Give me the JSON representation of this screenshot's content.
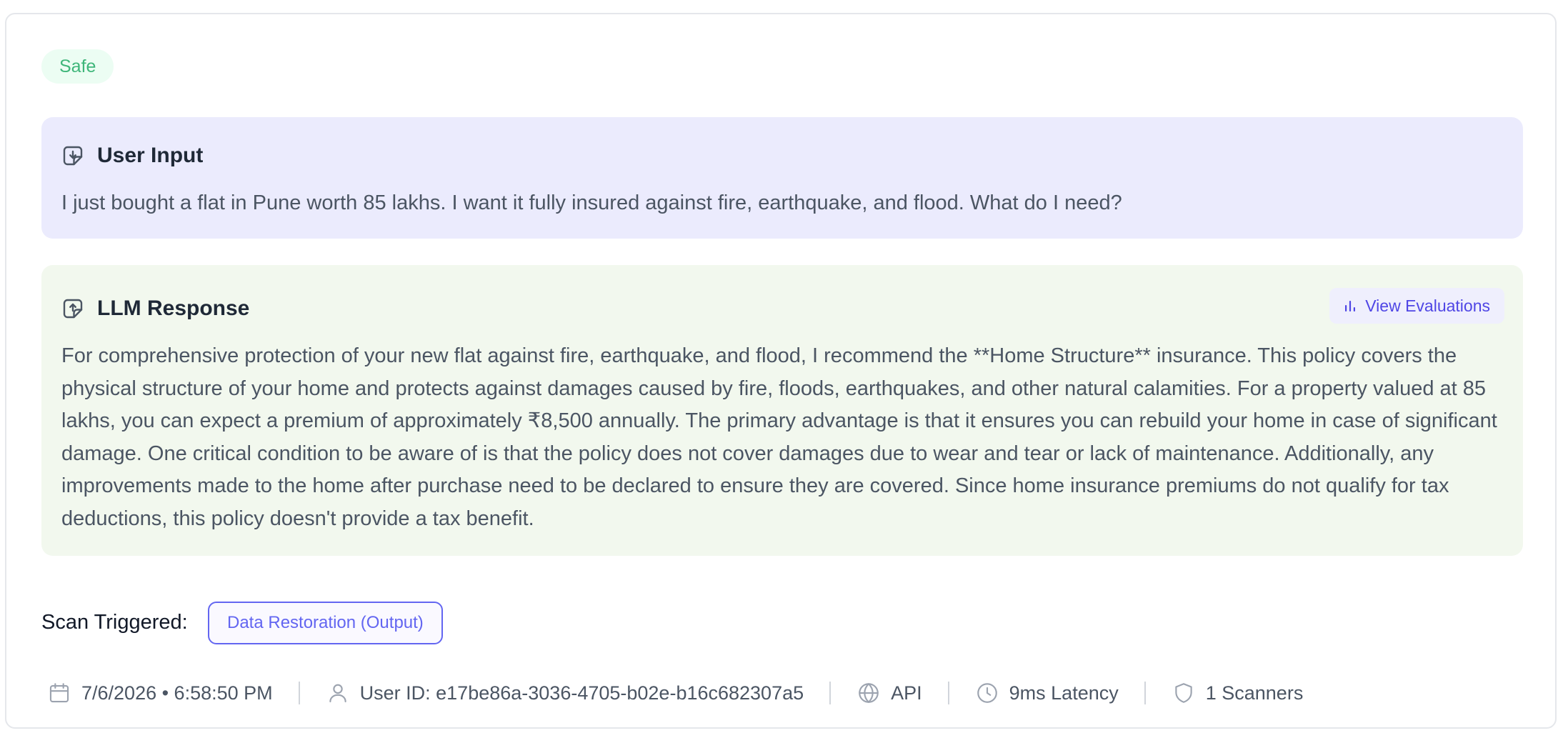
{
  "status_badge": {
    "label": "Safe",
    "color": "#3fb67a"
  },
  "user_input": {
    "title": "User Input",
    "icon": "message-input-icon",
    "text": "I just bought a flat in Pune worth 85 lakhs. I want it fully insured against fire, earthquake, and flood. What do I need?"
  },
  "llm_response": {
    "title": "LLM Response",
    "icon": "message-output-icon",
    "view_button": {
      "label": "View Evaluations",
      "icon": "bar-chart-icon"
    },
    "text": "For comprehensive protection of your new flat against fire, earthquake, and flood, I recommend the **Home Structure** insurance. This policy covers the physical structure of your home and protects against damages caused by fire, floods, earthquakes, and other natural calamities. For a property valued at 85 lakhs, you can expect a premium of approximately ₹8,500 annually. The primary advantage is that it ensures you can rebuild your home in case of significant damage. One critical condition to be aware of is that the policy does not cover damages due to wear and tear or lack of maintenance. Additionally, any improvements made to the home after purchase need to be declared to ensure they are covered. Since home insurance premiums do not qualify for tax deductions, this policy doesn't provide a tax benefit."
  },
  "scan": {
    "label": "Scan Triggered:",
    "chip": "Data Restoration (Output)"
  },
  "meta": {
    "datetime": "7/6/2026 • 6:58:50 PM",
    "user_id": "User ID: e17be86a-3036-4705-b02e-b16c682307a5",
    "source": "API",
    "latency": "9ms Latency",
    "scanners": "1 Scanners"
  },
  "colors": {
    "accent": "#6366f1",
    "input_panel": "#ebebfd",
    "response_panel": "#f2f8ee"
  }
}
